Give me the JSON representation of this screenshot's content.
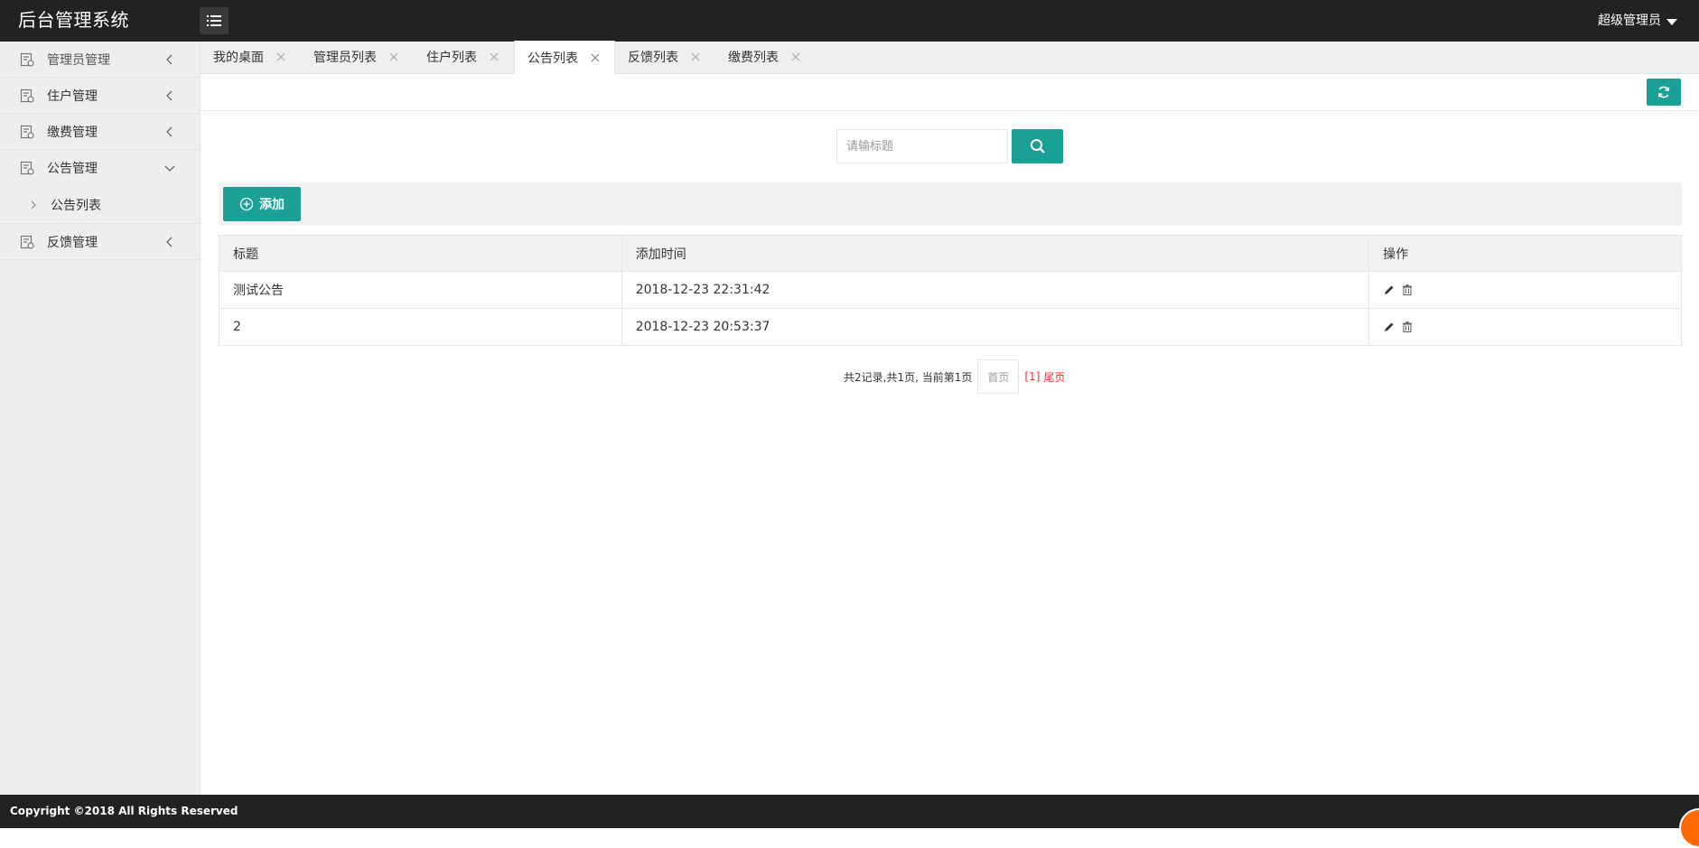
{
  "header": {
    "brand": "后台管理系统",
    "user": "超级管理员"
  },
  "sidebar": {
    "items": [
      {
        "label": "管理员管理",
        "icon": "form-icon",
        "chevron": "chevron-left-icon"
      },
      {
        "label": "住户管理",
        "icon": "form-icon",
        "chevron": "chevron-left-icon"
      },
      {
        "label": "缴费管理",
        "icon": "form-icon",
        "chevron": "chevron-left-icon"
      },
      {
        "label": "公告管理",
        "icon": "form-icon",
        "chevron": "chevron-down-icon",
        "children": [
          {
            "label": "公告列表"
          }
        ]
      },
      {
        "label": "反馈管理",
        "icon": "form-icon",
        "chevron": "chevron-left-icon"
      }
    ]
  },
  "tabs": [
    {
      "label": "我的桌面",
      "active": false
    },
    {
      "label": "管理员列表",
      "active": false
    },
    {
      "label": "住户列表",
      "active": false
    },
    {
      "label": "公告列表",
      "active": true
    },
    {
      "label": "反馈列表",
      "active": false
    },
    {
      "label": "缴费列表",
      "active": false
    }
  ],
  "search": {
    "placeholder": "请输标题",
    "value": ""
  },
  "actions": {
    "add_label": "添加"
  },
  "table": {
    "columns": [
      "标题",
      "添加时间",
      "操作"
    ],
    "rows": [
      {
        "title": "测试公告",
        "time": "2018-12-23 22:31:42"
      },
      {
        "title": "2",
        "time": "2018-12-23 20:53:37"
      }
    ]
  },
  "pagination": {
    "summary": "共2记录,共1页, 当前第1页",
    "first": "首页",
    "current": "[1]",
    "last": "尾页"
  },
  "footer": {
    "copyright": "Copyright ©2018 All Rights Reserved"
  },
  "colors": {
    "header_bg": "#222222",
    "accent": "#1aa094",
    "sidebar_bg": "#eeeeee",
    "current_page": "#ff2a2a"
  }
}
